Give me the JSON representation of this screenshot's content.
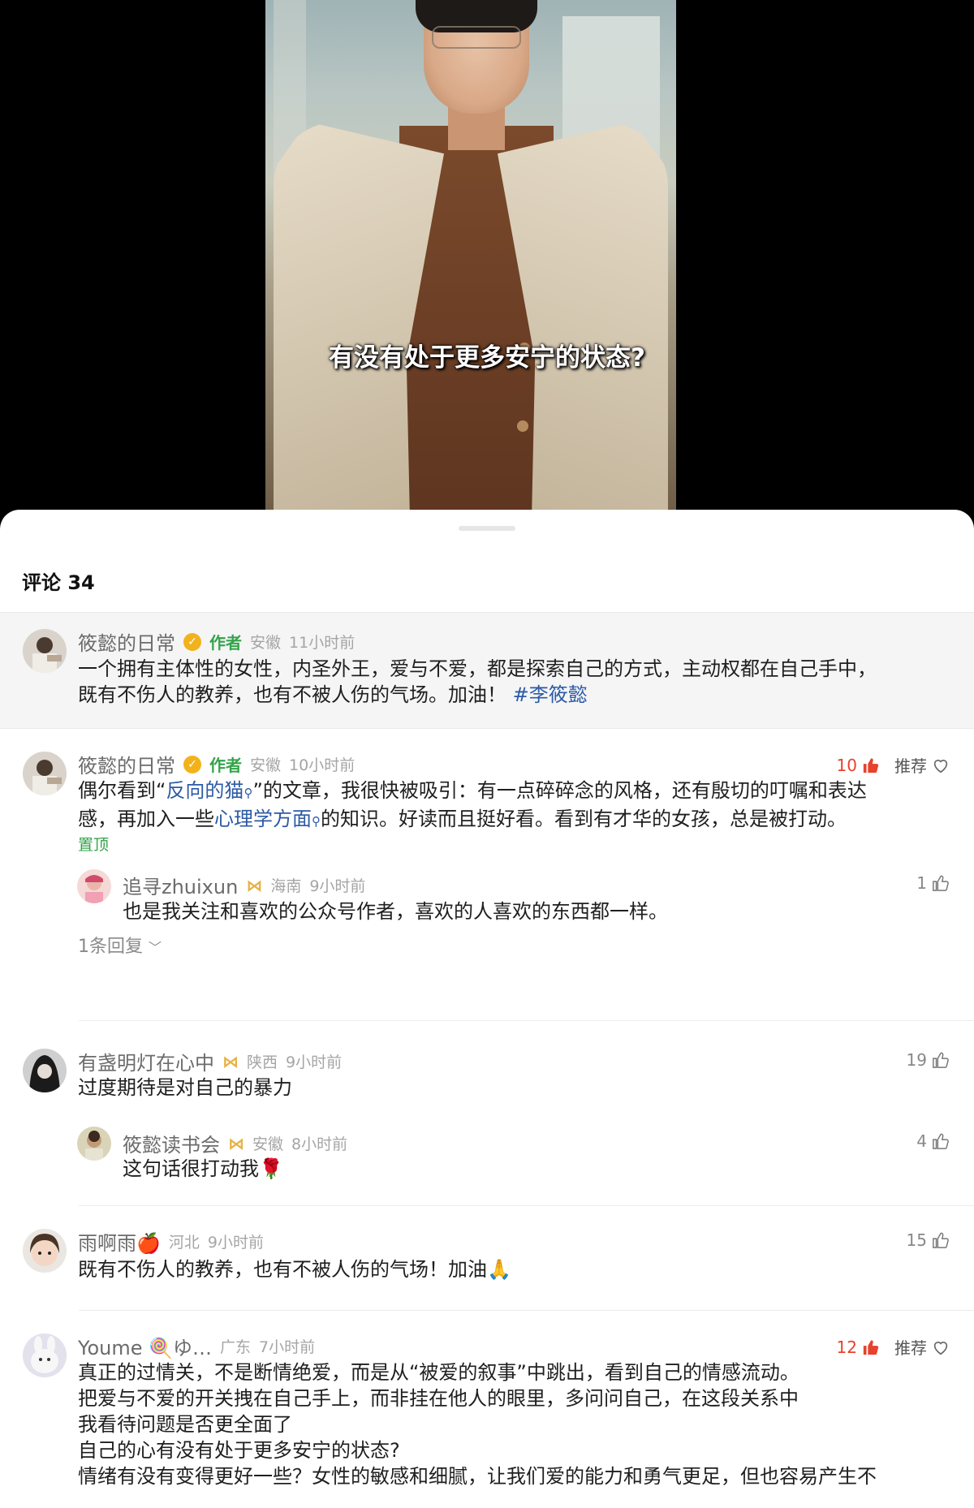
{
  "video": {
    "subtitle": "有没有处于更多安宁的状态?"
  },
  "sheet": {
    "title": "评论 34"
  },
  "comments": [
    {
      "name": "筱懿的日常",
      "author_badge": "作者",
      "region": "安徽",
      "time": "11小时前",
      "text_parts": [
        "一个拥有主体性的女性，内圣外王，爱与不爱，都是探索自己的方式，主动权都在自己手中，",
        "既有不伤人的教养，也有不被人伤的气场。加油！"
      ],
      "hashtag": "#李筱懿"
    },
    {
      "name": "筱懿的日常",
      "author_badge": "作者",
      "region": "安徽",
      "time": "10小时前",
      "likes": "10",
      "recommend": "推荐",
      "line1_pre": "偶尔看到“",
      "line1_link": "反向的猫",
      "line1_post": "”的文章，我很快被吸引：有一点碎碎念的风格，还有殷切的叮嘱和表达",
      "line2_pre": "感，再加入一些",
      "line2_link": "心理学方面",
      "line2_post": "的知识。好读而且挺好看。看到有才华的女孩，总是被打动。",
      "pin": "置顶",
      "reply": {
        "name": "追寻zhuixun",
        "region": "海南",
        "time": "9小时前",
        "likes": "1",
        "text": "也是我关注和喜欢的公众号作者，喜欢的人喜欢的东西都一样。"
      },
      "more_replies": "1条回复"
    },
    {
      "name": "有盏明灯在心中",
      "region": "陕西",
      "time": "9小时前",
      "likes": "19",
      "text": "过度期待是对自己的暴力",
      "reply": {
        "name": "筱懿读书会",
        "region": "安徽",
        "time": "8小时前",
        "likes": "4",
        "text": "这句话很打动我🌹"
      }
    },
    {
      "name": "雨啊雨🍎",
      "region": "河北",
      "time": "9小时前",
      "likes": "15",
      "text": "既有不伤人的教养，也有不被人伤的气场！加油🙏"
    },
    {
      "name": "Youme 🍭ゆ…",
      "region": "广东",
      "time": "7小时前",
      "likes": "12",
      "recommend": "推荐",
      "lines": [
        "真正的过情关，不是断情绝爱，而是从“被爱的叙事”中跳出，看到自己的情感流动。",
        "把爱与不爱的开关拽在自己手上，而非挂在他人的眼里，多问问自己，在这段关系中",
        "我看待问题是否更全面了",
        "自己的心有没有处于更多安宁的状态?",
        "情绪有没有变得更好一些？女性的敏感和细腻，让我们爱的能力和勇气更足，但也容易产生不"
      ]
    }
  ],
  "icons": {
    "like": "thumb-up-icon",
    "recommend": "heart-icon",
    "verified": "verified-badge-icon",
    "vip": "vip-bow-icon",
    "chevron": "chevron-down-icon",
    "search": "search-icon"
  },
  "colors": {
    "author_green": "#33a34a",
    "link_blue": "#2c5aa5",
    "like_red": "#e8412e",
    "pinned_bg": "#f5f5f5"
  }
}
